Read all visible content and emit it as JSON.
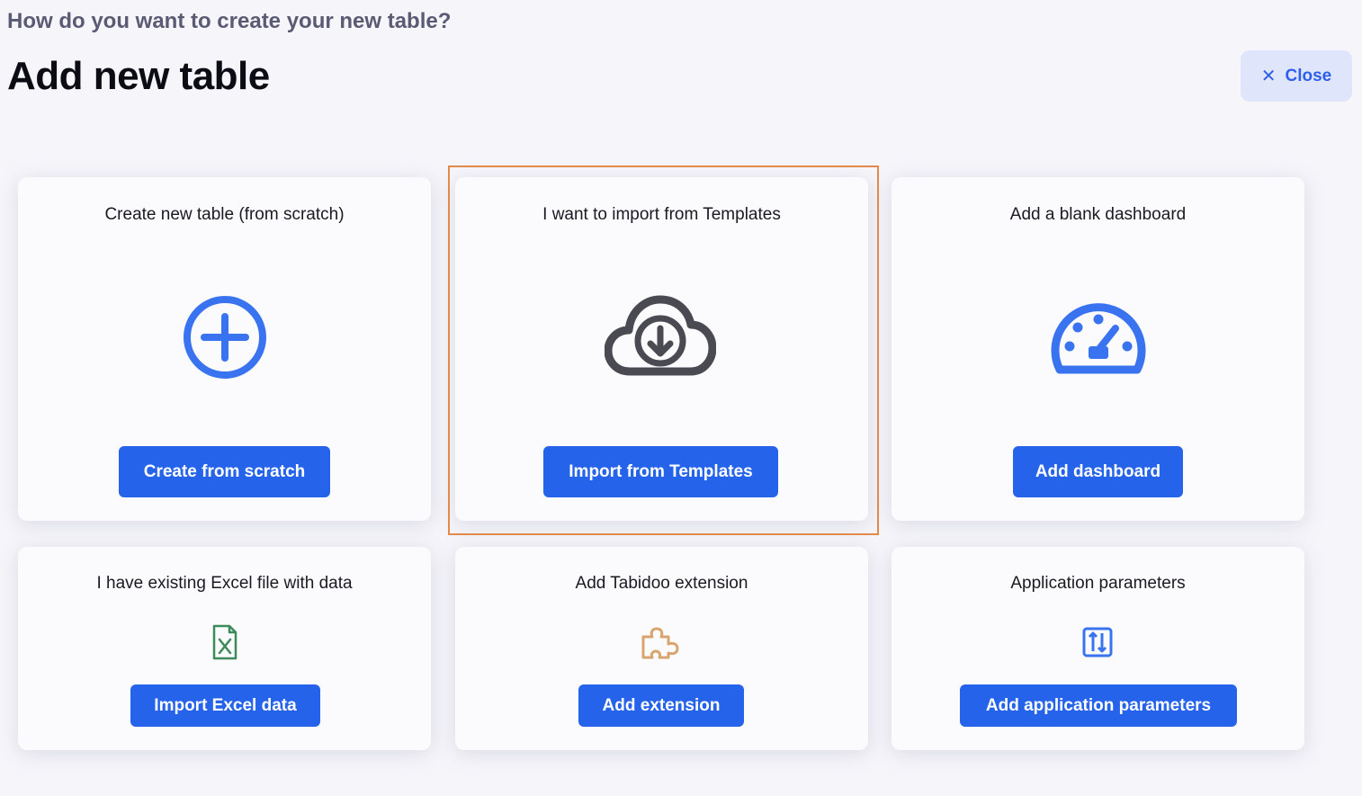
{
  "header": {
    "subtitle": "How do you want to create your new table?",
    "title": "Add new table",
    "close_label": "Close",
    "close_icon": "close-icon"
  },
  "cards": [
    {
      "title": "Create new table (from scratch)",
      "icon": "plus-circle-icon",
      "icon_color": "#3a73f0",
      "button": "Create from scratch"
    },
    {
      "title": "I want to import from Templates",
      "icon": "cloud-download-icon",
      "icon_color": "#4a4a52",
      "button": "Import from Templates",
      "highlighted": true
    },
    {
      "title": "Add a blank dashboard",
      "icon": "dashboard-gauge-icon",
      "icon_color": "#3a73f0",
      "button": "Add dashboard"
    },
    {
      "title": "I have existing Excel file with data",
      "icon": "excel-file-icon",
      "icon_color": "#3d8b5a",
      "button": "Import Excel data"
    },
    {
      "title": "Add Tabidoo extension",
      "icon": "puzzle-icon",
      "icon_color": "#d8a56e",
      "button": "Add extension"
    },
    {
      "title": "Application parameters",
      "icon": "parameters-icon",
      "icon_color": "#3a73f0",
      "button": "Add application parameters"
    }
  ],
  "colors": {
    "background": "#f5f5fa",
    "card": "#fbfbfe",
    "primary_button": "#2563eb",
    "close_button_bg": "#dfe6fb",
    "close_button_text": "#2f5fe9",
    "highlight_border": "#e28a4a"
  }
}
